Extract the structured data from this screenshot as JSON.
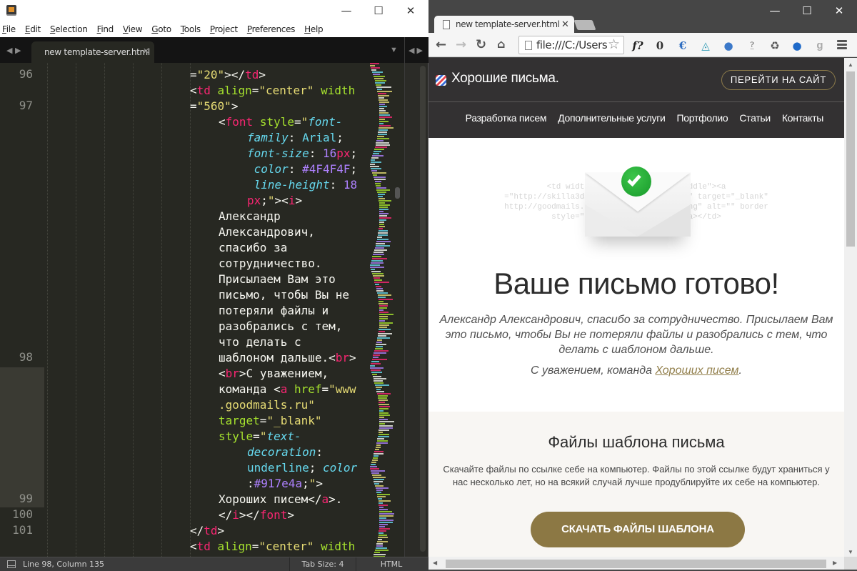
{
  "editor": {
    "app": "Sublime Text",
    "menu": [
      "File",
      "Edit",
      "Selection",
      "Find",
      "View",
      "Goto",
      "Tools",
      "Project",
      "Preferences",
      "Help"
    ],
    "tab_title": "new template-server.html",
    "line_numbers": [
      {
        "n": "96",
        "row": 1
      },
      {
        "n": "97",
        "row": 3
      },
      {
        "n": "98",
        "row": 19
      },
      {
        "n": "99",
        "row": 28
      },
      {
        "n": "100",
        "row": 29
      },
      {
        "n": "101",
        "row": 30
      }
    ],
    "code_lines": [
      {
        "indent": 0,
        "html": "<span class=\"p\">=</span><span class=\"s\">\"20\"</span><span class=\"p\">&gt;&lt;/</span><span class=\"t\">td</span><span class=\"p\">&gt;</span>"
      },
      {
        "indent": 0,
        "html": "<span class=\"p\">&lt;</span><span class=\"t\">td</span> <span class=\"a\">align</span><span class=\"p\">=</span><span class=\"s\">\"center\"</span> <span class=\"a\">width</span>"
      },
      {
        "indent": 0,
        "html": "<span class=\"p\">=</span><span class=\"s\">\"560\"</span><span class=\"p\">&gt;</span>"
      },
      {
        "indent": 1,
        "html": "<span class=\"p\">&lt;</span><span class=\"t\">font</span> <span class=\"a\">style</span><span class=\"p\">=</span><span class=\"s\">\"</span><span class=\"pr\">font-</span>"
      },
      {
        "indent": 2,
        "html": "<span class=\"pr\">family</span><span class=\"p\">:</span> <span class=\"v\">Arial</span><span class=\"p\">;</span>"
      },
      {
        "indent": 2,
        "html": "<span class=\"pr\">font-size</span><span class=\"p\">:</span> <span class=\"n\">16</span><span class=\"u\">px</span><span class=\"p\">;</span>"
      },
      {
        "indent": 2,
        "html": " <span class=\"pr\">color</span><span class=\"p\">:</span> <span class=\"n\">#4F4F4F</span><span class=\"p\">;</span>"
      },
      {
        "indent": 2,
        "html": " <span class=\"pr\">line-height</span><span class=\"p\">:</span> <span class=\"n\">18</span>"
      },
      {
        "indent": 2,
        "html": "<span class=\"u\">px</span><span class=\"p\">;</span><span class=\"s\">\"</span><span class=\"p\">&gt;&lt;</span><span class=\"t\">i</span><span class=\"p\">&gt;</span>"
      },
      {
        "indent": 1,
        "html": "Александр"
      },
      {
        "indent": 1,
        "html": "Александрович,"
      },
      {
        "indent": 1,
        "html": "спасибо за"
      },
      {
        "indent": 1,
        "html": "сотрудничество."
      },
      {
        "indent": 1,
        "html": "Присылаем Вам это"
      },
      {
        "indent": 1,
        "html": "письмо, чтобы Вы не"
      },
      {
        "indent": 1,
        "html": "потеряли файлы и"
      },
      {
        "indent": 1,
        "html": "разобрались с тем,"
      },
      {
        "indent": 1,
        "html": "что делать с"
      },
      {
        "indent": 1,
        "html": "шаблоном дальше.<span class=\"p\">&lt;</span><span class=\"t\">br</span><span class=\"p\">&gt;</span>"
      },
      {
        "indent": 1,
        "html": "<span class=\"p\">&lt;</span><span class=\"t\">br</span><span class=\"p\">&gt;</span>С уважением,"
      },
      {
        "indent": 1,
        "html": "команда <span class=\"p\">&lt;</span><span class=\"t\">a</span> <span class=\"a\">href</span><span class=\"p\">=</span><span class=\"s\">\"www</span>"
      },
      {
        "indent": 1,
        "html": "<span class=\"s\">.goodmails.ru\"</span>"
      },
      {
        "indent": 1,
        "html": "<span class=\"a\">target</span><span class=\"p\">=</span><span class=\"s\">\"_blank\"</span>"
      },
      {
        "indent": 1,
        "html": "<span class=\"a\">style</span><span class=\"p\">=</span><span class=\"s\">\"</span><span class=\"pr\">text-</span>"
      },
      {
        "indent": 2,
        "html": "<span class=\"pr\">decoration</span><span class=\"p\">:</span>"
      },
      {
        "indent": 2,
        "html": "<span class=\"v\">underline</span><span class=\"p\">;</span> <span class=\"pr\">color</span>"
      },
      {
        "indent": 2,
        "html": "<span class=\"p\">:</span><span class=\"n\">#917e4a</span><span class=\"p\">;</span><span class=\"s\">\"</span><span class=\"p\">&gt;</span>"
      },
      {
        "indent": 1,
        "html": "Хороших писем<span class=\"p\">&lt;/</span><span class=\"t\">a</span><span class=\"p\">&gt;.</span>"
      },
      {
        "indent": 1,
        "html": "<span class=\"p\">&lt;/</span><span class=\"t\">i</span><span class=\"p\">&gt;&lt;/</span><span class=\"t\">font</span><span class=\"p\">&gt;</span>"
      },
      {
        "indent": 0,
        "html": "<span class=\"p\">&lt;/</span><span class=\"t\">td</span><span class=\"p\">&gt;</span>"
      },
      {
        "indent": 0,
        "html": "<span class=\"p\">&lt;</span><span class=\"t\">td</span> <span class=\"a\">align</span><span class=\"p\">=</span><span class=\"s\">\"center\"</span> <span class=\"a\">width</span>"
      }
    ],
    "status": {
      "position": "Line 98, Column 135",
      "tab_size": "Tab Size: 4",
      "syntax": "HTML"
    }
  },
  "browser": {
    "tab_title": "new template-server.html",
    "url": "file:///C:/Users",
    "extensions": [
      "f?",
      "ghostery",
      "euro",
      "evernote",
      "globe",
      "unknown",
      "recycle",
      "world",
      "google",
      "menu"
    ],
    "site": {
      "logo": "Хорошие письма.",
      "goto_button": "ПЕРЕЙТИ НА САЙТ",
      "nav": [
        "Разработка писем",
        "Дополнительные услуги",
        "Портфолио",
        "Статьи",
        "Контакты"
      ],
      "ghost_code": "<td width=\"150          gn=\"middle\"><a\n=\"http://skilla3d.ru/                ls\" target=\"_blank\"\nhttp://goodmails.ru/                o.png\" alt=\"\" border\nstyle=\"b                     a></td>",
      "hero_title": "Ваше письмо готово!",
      "hero_body": "Александр Александрович, спасибо за сотрудничество. Присылаем Вам это письмо, чтобы Вы не потеряли файлы и разобрались с тем, что делать с шаблоном дальше.",
      "sign_prefix": "С уважением, команда ",
      "sign_link": "Хороших писем",
      "sign_suffix": ".",
      "files_title": "Файлы шаблона письма",
      "files_body": "Скачайте файлы по ссылке себе на компьютер. Файлы по этой ссылке будут храниться у нас несколько лет, но на всякий случай лучше продублируйте их себе на компьютер.",
      "download_button": "СКАЧАТЬ ФАЙЛЫ ШАБЛОНА"
    },
    "colors": {
      "link": "#917e4a",
      "button": "#8c7844",
      "header_bg": "#333132"
    }
  }
}
